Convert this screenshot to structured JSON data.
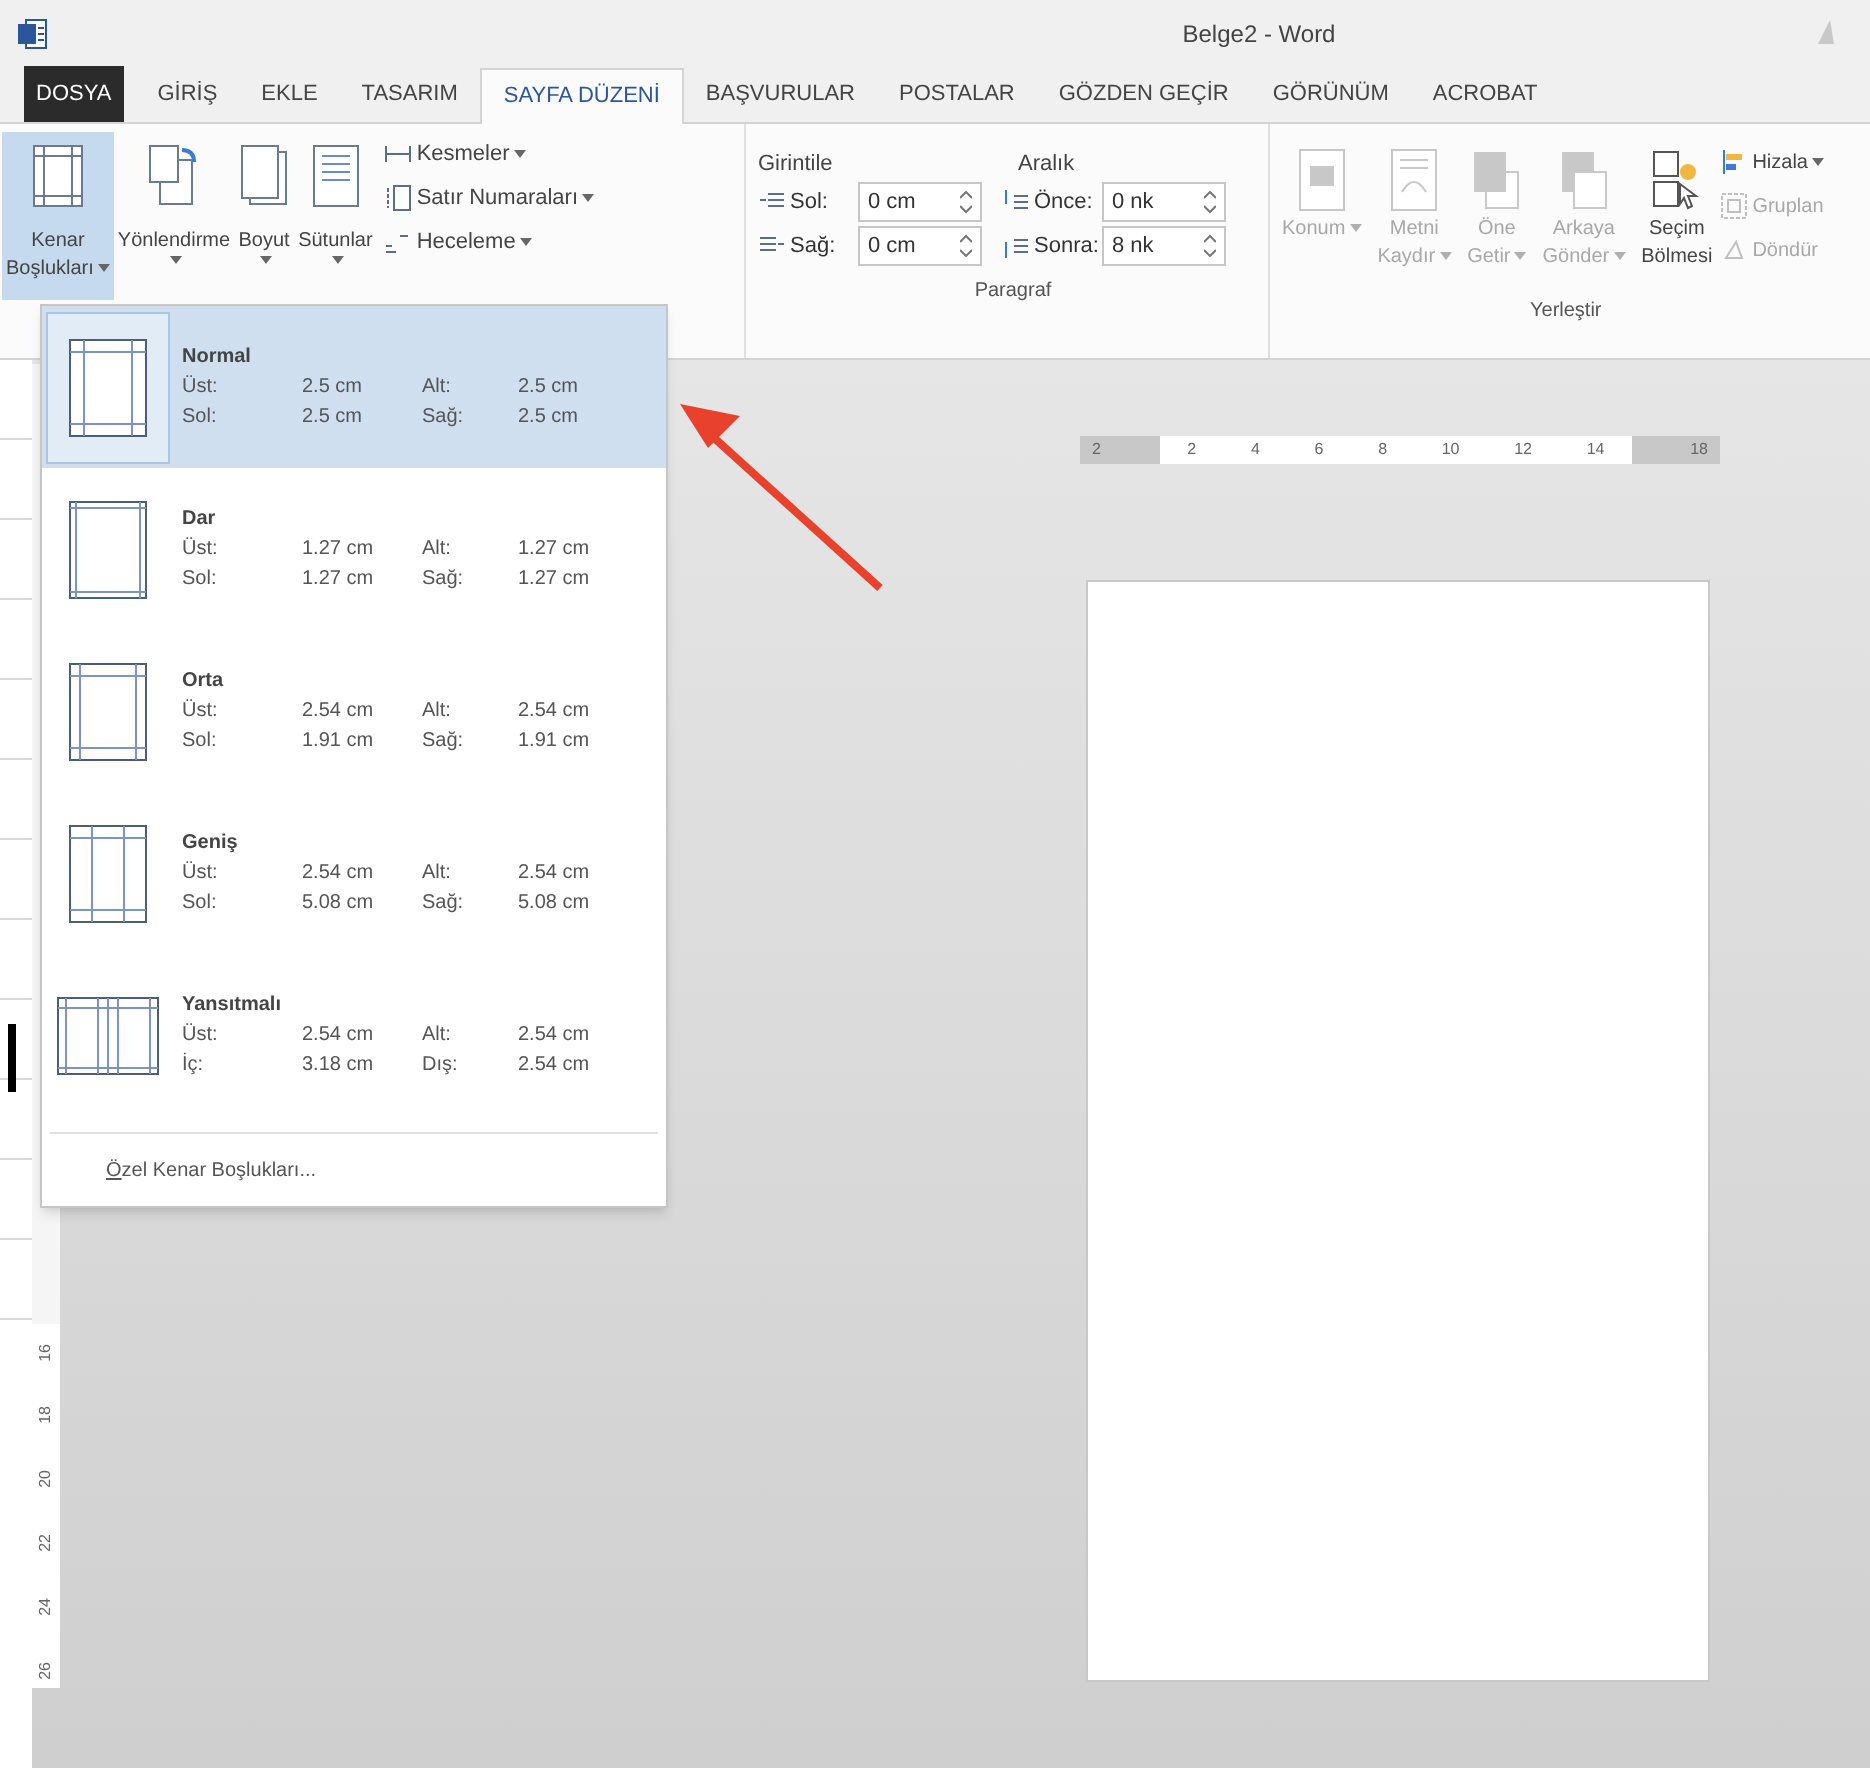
{
  "window": {
    "title": "Belge2 - Word"
  },
  "tabs": [
    {
      "label": "DOSYA",
      "kind": "file",
      "selected": false
    },
    {
      "label": "GİRİŞ",
      "kind": "tab",
      "selected": false
    },
    {
      "label": "EKLE",
      "kind": "tab",
      "selected": false
    },
    {
      "label": "TASARIM",
      "kind": "tab",
      "selected": false
    },
    {
      "label": "SAYFA DÜZENİ",
      "kind": "tab",
      "selected": true
    },
    {
      "label": "BAŞVURULAR",
      "kind": "tab",
      "selected": false
    },
    {
      "label": "POSTALAR",
      "kind": "tab",
      "selected": false
    },
    {
      "label": "GÖZDEN GEÇİR",
      "kind": "tab",
      "selected": false
    },
    {
      "label": "GÖRÜNÜM",
      "kind": "tab",
      "selected": false
    },
    {
      "label": "ACROBAT",
      "kind": "tab",
      "selected": false
    }
  ],
  "page_setup": {
    "large_buttons": [
      {
        "lines": [
          "Kenar",
          "Boşlukları"
        ],
        "kind": "margins",
        "selected": true
      },
      {
        "lines": [
          "Yönlendirme"
        ],
        "kind": "orientation",
        "selected": false
      },
      {
        "lines": [
          "Boyut"
        ],
        "kind": "size",
        "selected": false
      },
      {
        "lines": [
          "Sütunlar"
        ],
        "kind": "columns",
        "selected": false
      }
    ],
    "small_buttons": [
      {
        "label": "Kesmeler",
        "kind": "breaks"
      },
      {
        "label": "Satır Numaraları",
        "kind": "numbers"
      },
      {
        "label": "Heceleme",
        "kind": "hyphenation"
      }
    ]
  },
  "paragraph": {
    "title": "Paragraf",
    "indent_heading": "Girintile",
    "spacing_heading": "Aralık",
    "indent_fields": [
      {
        "label": "Sol:",
        "value": "0 cm"
      },
      {
        "label": "Sağ:",
        "value": "0 cm"
      }
    ],
    "spacing_fields": [
      {
        "label": "Önce:",
        "value": "0 nk"
      },
      {
        "label": "Sonra:",
        "value": "8 nk"
      }
    ]
  },
  "arrange": {
    "title": "Yerleştir",
    "large_buttons": [
      {
        "lines": [
          "Konum"
        ],
        "kind": "position",
        "disabled": true
      },
      {
        "lines": [
          "Metni",
          "Kaydır"
        ],
        "kind": "wrap",
        "disabled": true
      },
      {
        "lines": [
          "Öne",
          "Getir"
        ],
        "kind": "forward",
        "disabled": true
      },
      {
        "lines": [
          "Arkaya",
          "Gönder"
        ],
        "kind": "backward",
        "disabled": true
      },
      {
        "lines": [
          "Seçim",
          "Bölmesi"
        ],
        "kind": "selection",
        "disabled": false
      }
    ],
    "small_buttons": [
      {
        "label": "Hizala",
        "kind": "align",
        "disabled": false
      },
      {
        "label": "Gruplan",
        "kind": "group",
        "disabled": true
      },
      {
        "label": "Döndür",
        "kind": "rotate",
        "disabled": true
      }
    ]
  },
  "margins_menu": {
    "items": [
      {
        "name": "Normal",
        "kind": "normal",
        "selected": true,
        "rows": [
          [
            "Üst:",
            "2.5 cm",
            "Alt:",
            "2.5 cm"
          ],
          [
            "Sol:",
            "2.5 cm",
            "Sağ:",
            "2.5 cm"
          ]
        ]
      },
      {
        "name": "Dar",
        "kind": "narrow",
        "selected": false,
        "rows": [
          [
            "Üst:",
            "1.27 cm",
            "Alt:",
            "1.27 cm"
          ],
          [
            "Sol:",
            "1.27 cm",
            "Sağ:",
            "1.27 cm"
          ]
        ]
      },
      {
        "name": "Orta",
        "kind": "moderate",
        "selected": false,
        "rows": [
          [
            "Üst:",
            "2.54 cm",
            "Alt:",
            "2.54 cm"
          ],
          [
            "Sol:",
            "1.91 cm",
            "Sağ:",
            "1.91 cm"
          ]
        ]
      },
      {
        "name": "Geniş",
        "kind": "wide",
        "selected": false,
        "rows": [
          [
            "Üst:",
            "2.54 cm",
            "Alt:",
            "2.54 cm"
          ],
          [
            "Sol:",
            "5.08 cm",
            "Sağ:",
            "5.08 cm"
          ]
        ]
      },
      {
        "name": "Yansıtmalı",
        "kind": "mirrored",
        "selected": false,
        "rows": [
          [
            "Üst:",
            "2.54 cm",
            "Alt:",
            "2.54 cm"
          ],
          [
            "İç:",
            "3.18 cm",
            "Dış:",
            "2.54 cm"
          ]
        ]
      }
    ],
    "footer": "Özel Kenar Boşlukları..."
  },
  "horizontal_ruler": {
    "left_label": "2",
    "labels": [
      "2",
      "4",
      "6",
      "8",
      "10",
      "12",
      "14"
    ],
    "right_label": "18"
  },
  "vertical_ruler": {
    "labels": [
      "16",
      "18",
      "20",
      "22",
      "24",
      "26"
    ]
  }
}
